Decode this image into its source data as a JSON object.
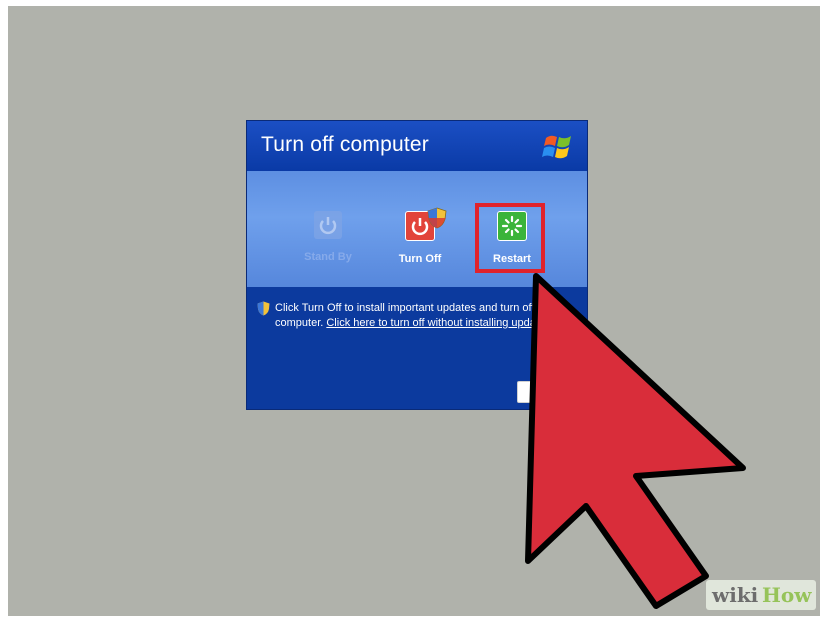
{
  "dialog": {
    "title": "Turn off computer",
    "options": [
      {
        "label": "Stand By",
        "state": "disabled"
      },
      {
        "label": "Turn Off",
        "state": "enabled"
      },
      {
        "label": "Restart",
        "state": "highlighted"
      }
    ],
    "info_text": "Click Turn Off to install important updates and turn off your computer. ",
    "info_link": "Click here to turn off without installing updates."
  },
  "annotation": {
    "highlight_color": "#e0232c",
    "arrow_color": "#d92d3a"
  },
  "watermark": {
    "logo_text": "wikiHow"
  },
  "icons": [
    "windows-logo-icon",
    "power-icon",
    "restart-icon",
    "shield-icon"
  ]
}
